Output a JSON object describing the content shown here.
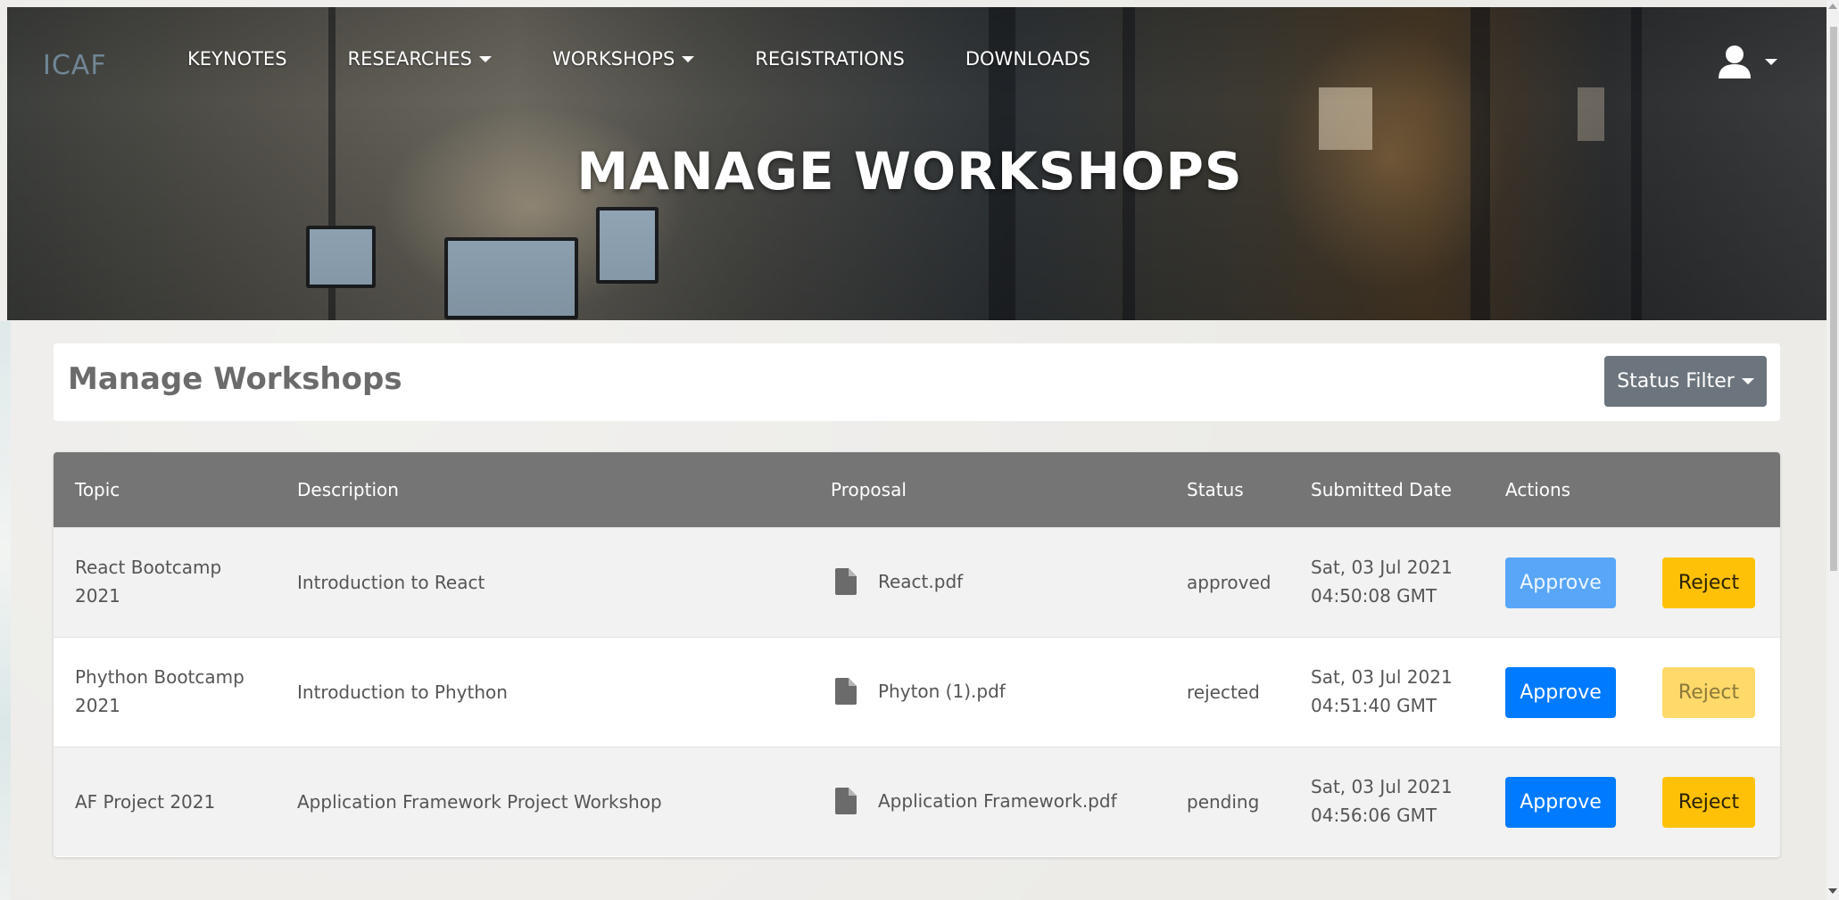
{
  "brand": {
    "logo_text": "ICAF"
  },
  "nav": {
    "items": [
      {
        "label": "KEYNOTES",
        "dropdown": false
      },
      {
        "label": "RESEARCHES",
        "dropdown": true
      },
      {
        "label": "WORKSHOPS",
        "dropdown": true
      },
      {
        "label": "REGISTRATIONS",
        "dropdown": false
      },
      {
        "label": "DOWNLOADS",
        "dropdown": false
      }
    ],
    "user_icon": "user-icon"
  },
  "hero": {
    "title": "MANAGE WORKSHOPS"
  },
  "header": {
    "title": "Manage Workshops",
    "filter_label": "Status Filter"
  },
  "table": {
    "columns": [
      "Topic",
      "Description",
      "Proposal",
      "Status",
      "Submitted Date",
      "Actions"
    ],
    "rows": [
      {
        "topic_line1": "React Bootcamp",
        "topic_line2": "2021",
        "description": "Introduction to React",
        "proposal": "React.pdf",
        "status": "approved",
        "date_line1": "Sat, 03 Jul 2021",
        "date_line2": "04:50:08 GMT",
        "approve": "Approve",
        "reject": "Reject"
      },
      {
        "topic_line1": "Phython Bootcamp",
        "topic_line2": "2021",
        "description": "Introduction to Phython",
        "proposal": "Phyton (1).pdf",
        "status": "rejected",
        "date_line1": "Sat, 03 Jul 2021",
        "date_line2": "04:51:40 GMT",
        "approve": "Approve",
        "reject": "Reject"
      },
      {
        "topic_line1": "AF Project 2021",
        "topic_line2": "",
        "description": "Application Framework Project Workshop",
        "proposal": "Application Framework.pdf",
        "status": "pending",
        "date_line1": "Sat, 03 Jul 2021",
        "date_line2": "04:56:06 GMT",
        "approve": "Approve",
        "reject": "Reject"
      }
    ]
  },
  "colors": {
    "primary": "#007bff",
    "warning": "#ffc107",
    "secondary": "#6c757d",
    "table_header": "#757575"
  }
}
